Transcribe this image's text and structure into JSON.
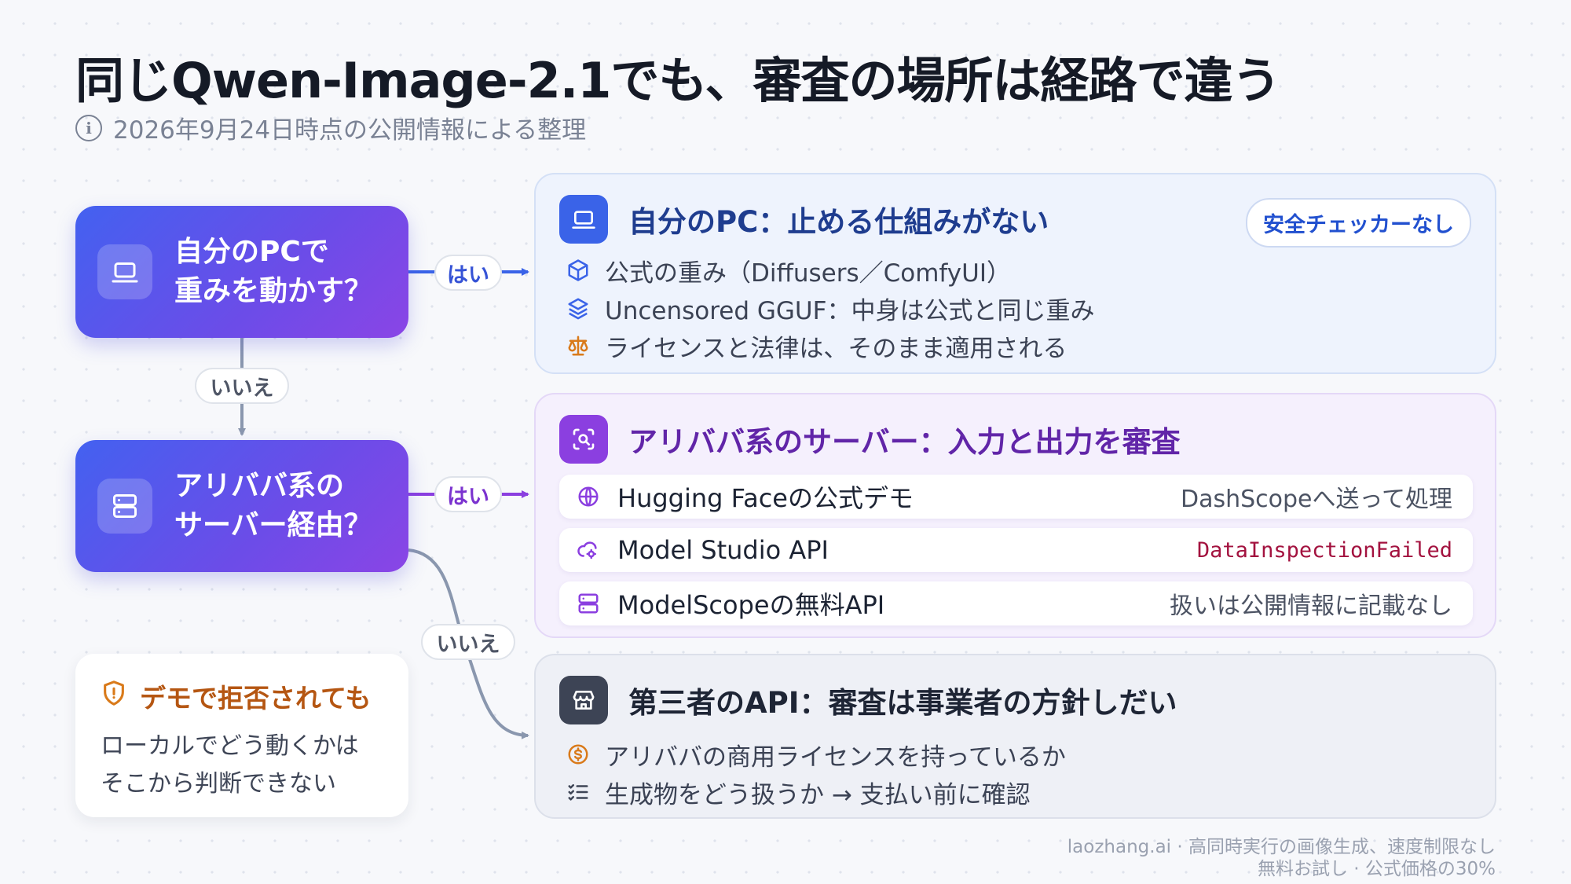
{
  "title": "同じQwen-Image-2.1でも、審査の場所は経路で違う",
  "subtitle": "2026年9月24日時点の公開情報による整理",
  "questions": [
    {
      "line1": "自分のPCで",
      "line2": "重みを動かす？",
      "icon": "laptop-icon"
    },
    {
      "line1": "アリババ系の",
      "line2": "サーバー経由？",
      "icon": "server-icon"
    }
  ],
  "edges": {
    "yes": "はい",
    "no": "いいえ"
  },
  "cards": {
    "pc": {
      "title": "自分のPC：止める仕組みがない",
      "badge": "安全チェッカーなし",
      "icon": "laptop-icon",
      "color": "#3a63e8",
      "items": [
        {
          "icon": "cube-icon",
          "text": "公式の重み（Diffusers／ComfyUI）"
        },
        {
          "icon": "layers-icon",
          "text": "Uncensored GGUF：中身は公式と同じ重み"
        },
        {
          "icon": "scale-icon",
          "text": "ライセンスと法律は、そのまま適用される"
        }
      ]
    },
    "alibaba": {
      "title": "アリババ系のサーバー：入力と出力を審査",
      "icon": "scan-search-icon",
      "color": "#8b3fe0",
      "rows": [
        {
          "icon": "globe-icon",
          "label": "Hugging Faceの公式デモ",
          "value": "DashScopeへ送って処理"
        },
        {
          "icon": "cloud-cog-icon",
          "label": "Model Studio API",
          "value": "DataInspectionFailed"
        },
        {
          "icon": "server-icon",
          "label": "ModelScopeの無料API",
          "value": "扱いは公開情報に記載なし"
        }
      ]
    },
    "third": {
      "title": "第三者のAPI：審査は事業者の方針しだい",
      "icon": "store-icon",
      "color": "#3d4455",
      "items": [
        {
          "icon": "dollar-circle-icon",
          "text": "アリババの商用ライセンスを持っているか"
        },
        {
          "icon": "checklist-icon",
          "text": "生成物をどう扱うか → 支払い前に確認"
        }
      ]
    }
  },
  "note": {
    "title": "デモで拒否されても",
    "line1": "ローカルでどう動くかは",
    "line2": "そこから判断できない",
    "icon": "shield-alert-icon"
  },
  "footer": {
    "line1": "laozhang.ai · 高同時実行の画像生成、速度制限なし",
    "line2": "無料お試し · 公式価格の30%"
  }
}
